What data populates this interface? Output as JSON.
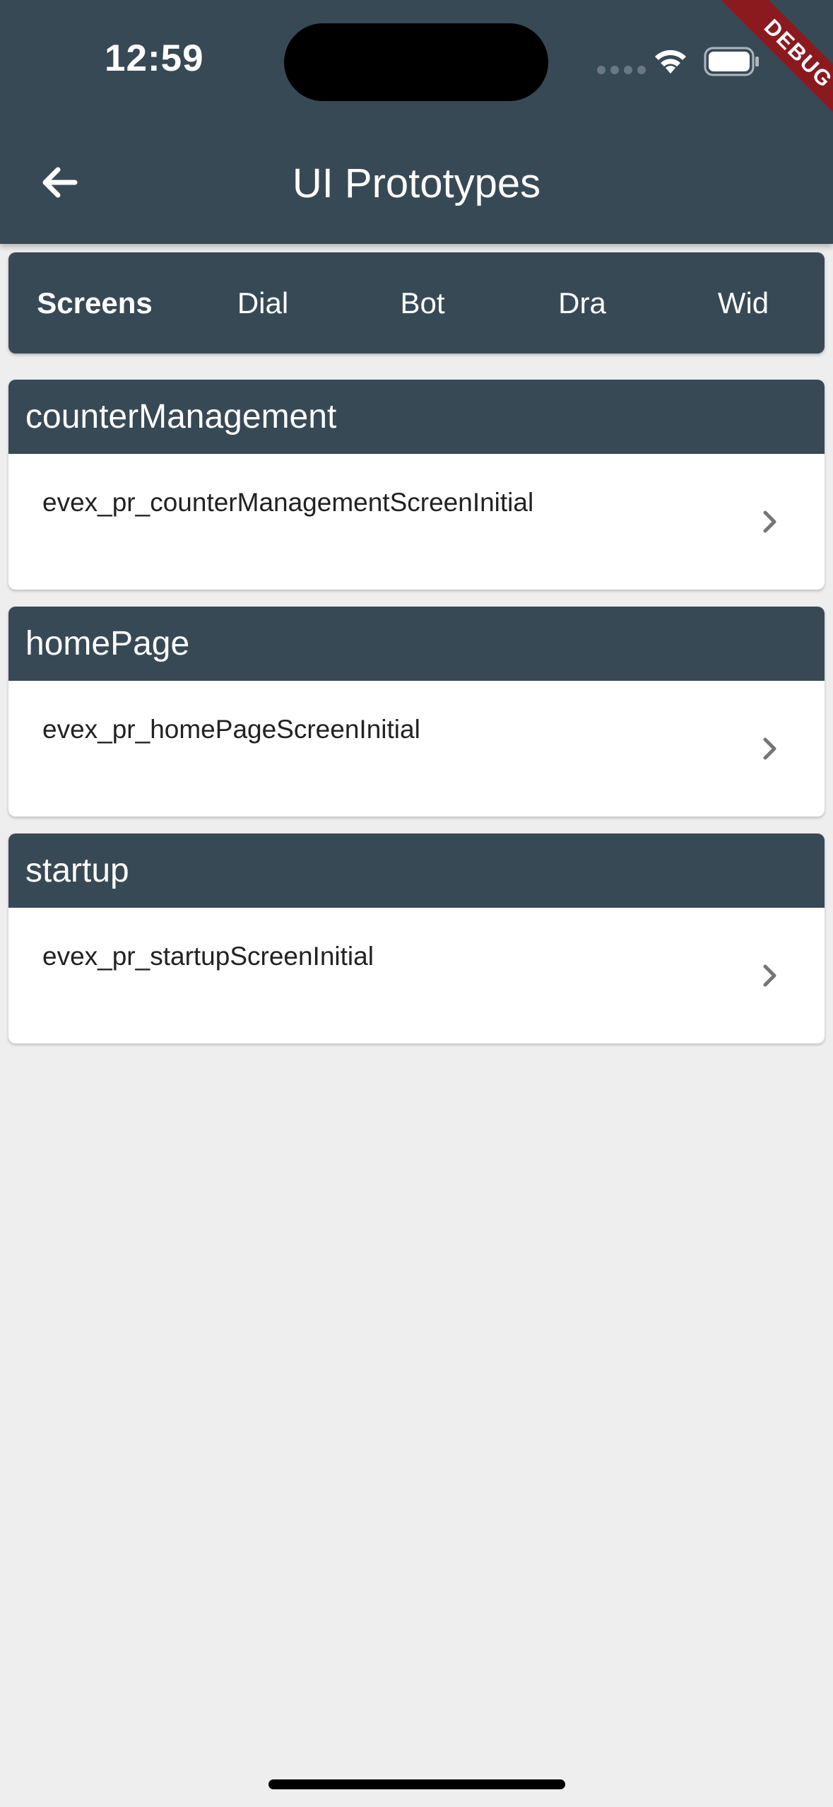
{
  "status_bar": {
    "time": "12:59",
    "icons": [
      "cellular-signal-icon",
      "wifi-icon",
      "battery-icon"
    ]
  },
  "debug_banner": "DEBUG",
  "app_bar": {
    "back_icon": "arrow-back-icon",
    "title": "UI Prototypes"
  },
  "tabs": [
    {
      "label": "Screens",
      "active": true
    },
    {
      "label": "Dial",
      "active": false
    },
    {
      "label": "Bot",
      "active": false
    },
    {
      "label": "Dra",
      "active": false
    },
    {
      "label": "Wid",
      "active": false
    }
  ],
  "groups": [
    {
      "title": "counterManagement",
      "items": [
        {
          "label": "evex_pr_counterManagementScreenInitial",
          "icon": "chevron-right-icon"
        }
      ]
    },
    {
      "title": "homePage",
      "items": [
        {
          "label": "evex_pr_homePageScreenInitial",
          "icon": "chevron-right-icon"
        }
      ]
    },
    {
      "title": "startup",
      "items": [
        {
          "label": "evex_pr_startupScreenInitial",
          "icon": "chevron-right-icon"
        }
      ]
    }
  ],
  "colors": {
    "primary": "#384956",
    "background": "#eeeeee",
    "debug": "#8b1a1f"
  }
}
